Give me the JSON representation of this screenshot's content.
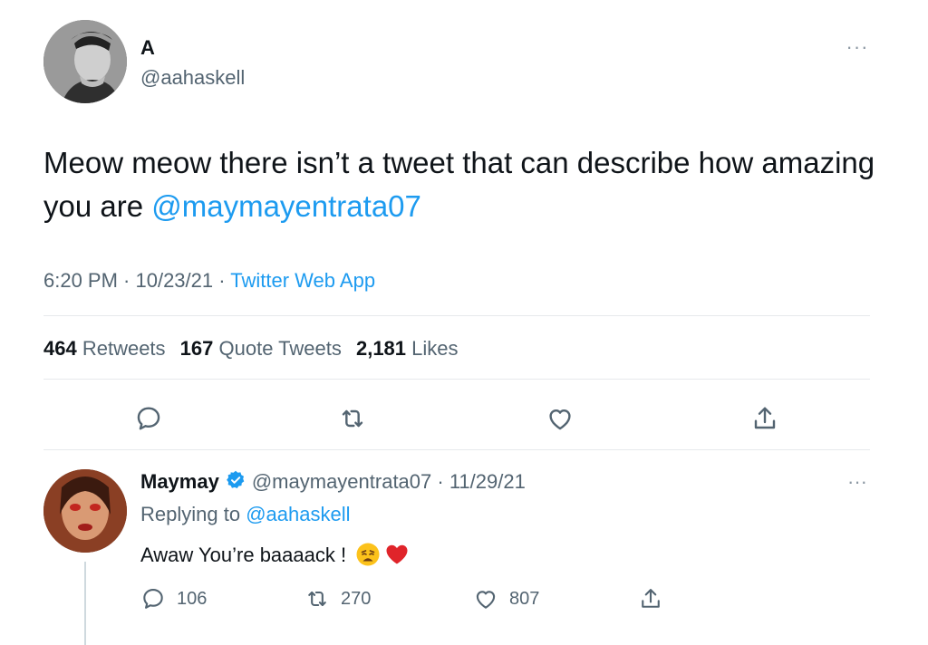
{
  "tweet": {
    "author_name": "A",
    "author_handle": "@aahaskell",
    "text": "Meow meow there isn’t a tweet that can describe how amazing you are ",
    "mention": "@maymayentrata07",
    "time": "6:20 PM · 10/23/21 · ",
    "source": "Twitter Web App",
    "stats": {
      "retweets_count": "464",
      "retweets_label": " Retweets",
      "quotes_count": "167",
      "quotes_label": " Quote Tweets",
      "likes_count": "2,181",
      "likes_label": " Likes"
    },
    "more": "···",
    "icons": [
      "reply-icon",
      "retweet-icon",
      "like-icon",
      "share-icon"
    ]
  },
  "reply": {
    "name": "Maymay",
    "handle_date": "@maymayentrata07 · 11/29/21",
    "replying_prefix": "Replying to ",
    "replying_to": "@aahaskell",
    "text": "Awaw You’re baaaack ! ",
    "more": "···",
    "replies": "106",
    "retweets": "270",
    "likes": "807",
    "emojis": [
      "weary-face-emoji",
      "red-heart-emoji"
    ]
  },
  "colors": {
    "link": "#1d9bf0",
    "verified": "#1d9bf0",
    "text": "#0f1419",
    "secondary": "#536471"
  }
}
